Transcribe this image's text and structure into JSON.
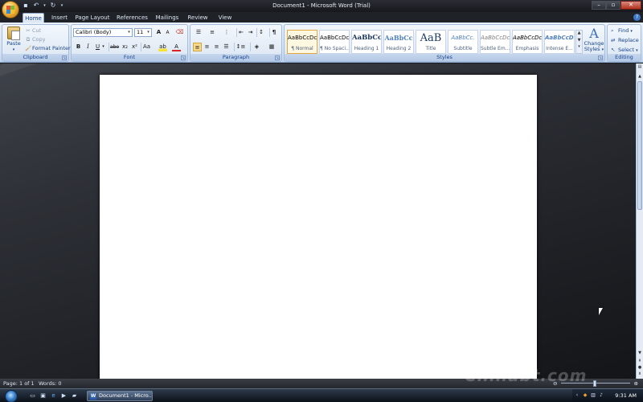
{
  "window": {
    "title": "Document1 - Microsoft Word (Trial)"
  },
  "qat": {
    "icons": [
      "save-icon",
      "undo-icon",
      "redo-icon",
      "customize-icon"
    ]
  },
  "tabs": [
    {
      "label": "Home",
      "active": true
    },
    {
      "label": "Insert"
    },
    {
      "label": "Page Layout"
    },
    {
      "label": "References"
    },
    {
      "label": "Mailings"
    },
    {
      "label": "Review"
    },
    {
      "label": "View"
    }
  ],
  "clipboard": {
    "paste_label": "Paste",
    "cut_label": "Cut",
    "copy_label": "Copy",
    "format_painter_label": "Format Painter",
    "group_label": "Clipboard"
  },
  "font": {
    "family": "Calibri (Body)",
    "size": "11",
    "group_label": "Font",
    "bold": "B",
    "italic": "I",
    "underline": "U",
    "strike": "abe",
    "subscript": "x₂",
    "superscript": "x²",
    "change_case": "Aa",
    "grow": "A",
    "shrink": "A",
    "font_color": "A"
  },
  "paragraph": {
    "group_label": "Paragraph",
    "show_hide": "¶"
  },
  "styles": {
    "group_label": "Styles",
    "items": [
      {
        "sample": "AaBbCcDc",
        "name": "¶ Normal"
      },
      {
        "sample": "AaBbCcDc",
        "name": "¶ No Spaci..."
      },
      {
        "sample": "AaBbCc",
        "name": "Heading 1"
      },
      {
        "sample": "AaBbCc",
        "name": "Heading 2"
      },
      {
        "sample": "AaB",
        "name": "Title"
      },
      {
        "sample": "AaBbCc.",
        "name": "Subtitle"
      },
      {
        "sample": "AaBbCcDc",
        "name": "Subtle Em..."
      },
      {
        "sample": "AaBbCcDc",
        "name": "Emphasis"
      },
      {
        "sample": "AaBbCcDc",
        "name": "Intense E..."
      }
    ],
    "change_styles_label_1": "Change",
    "change_styles_label_2": "Styles"
  },
  "editing": {
    "group_label": "Editing",
    "find_label": "Find",
    "replace_label": "Replace",
    "select_label": "Select"
  },
  "status": {
    "page": "Page: 1 of 1",
    "words": "Words: 0"
  },
  "taskbar": {
    "word_task_label": "Document1 - Micro...",
    "clock": "9:31 AM"
  },
  "watermark": "Chinabt.com",
  "colors": {
    "ribbon_bg": "#dbe6f4",
    "title_bar": "#1f2227",
    "workspace": "#2d3036",
    "active_style_border": "#e3a83b"
  }
}
